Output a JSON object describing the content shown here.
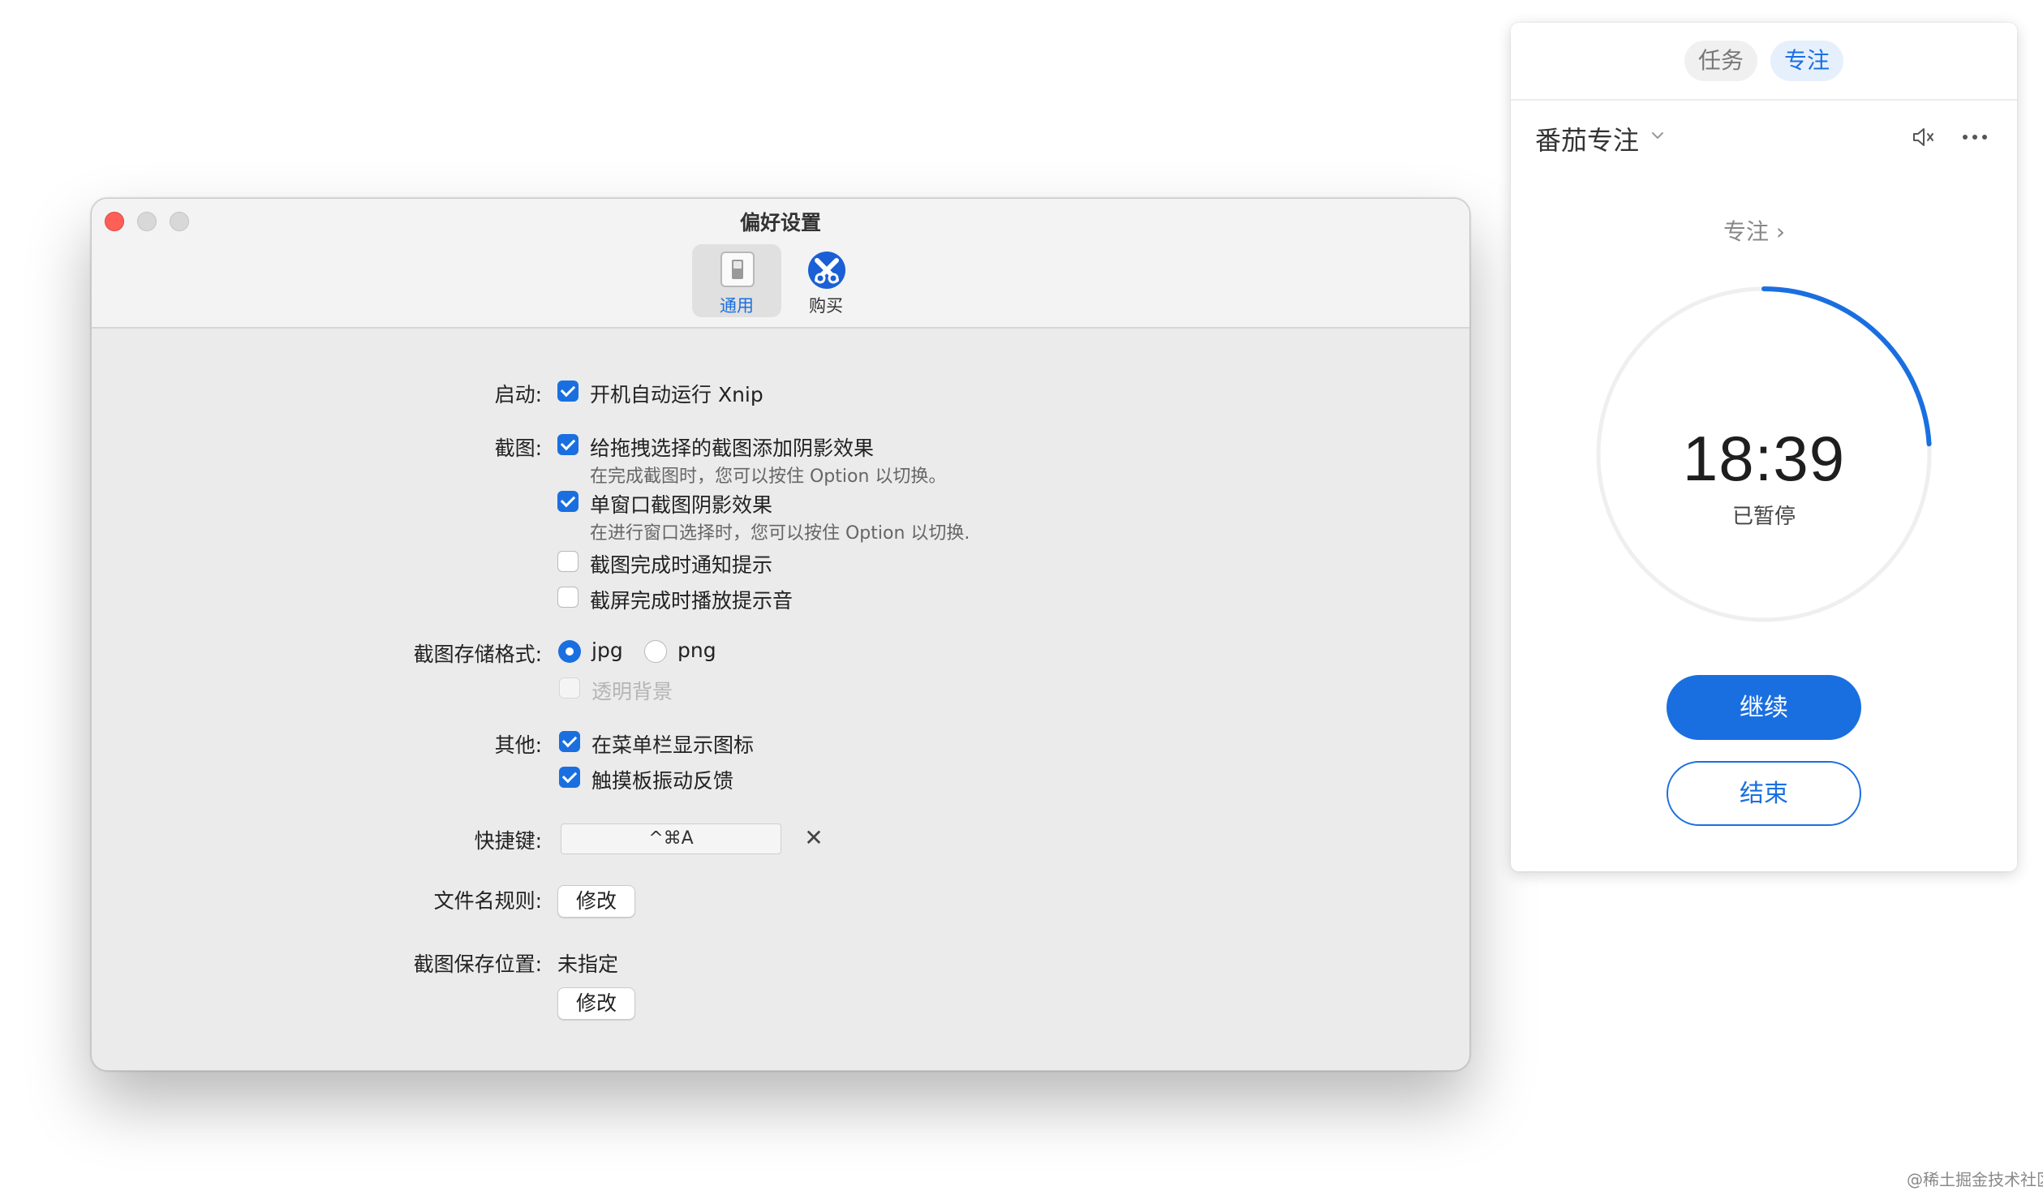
{
  "preferences": {
    "title": "偏好设置",
    "toolbar": {
      "general_label": "通用",
      "buy_label": "购买"
    },
    "startup": {
      "label": "启动:",
      "launch_at_login": {
        "text": "开机自动运行 Xnip",
        "checked": true
      }
    },
    "screenshot": {
      "label": "截图:",
      "drag_shadow": {
        "text": "给拖拽选择的截图添加阴影效果",
        "hint": "在完成截图时，您可以按住 Option 以切换。",
        "checked": true
      },
      "window_shadow": {
        "text": "单窗口截图阴影效果",
        "hint": "在进行窗口选择时，您可以按住 Option 以切换.",
        "checked": true
      },
      "notify_done": {
        "text": "截图完成时通知提示",
        "checked": false
      },
      "sound_done": {
        "text": "截屏完成时播放提示音",
        "checked": false
      }
    },
    "format": {
      "label": "截图存储格式:",
      "jpg": "jpg",
      "png": "png",
      "selected": "jpg",
      "transparent_bg": {
        "text": "透明背景",
        "checked": false,
        "disabled": true
      }
    },
    "other": {
      "label": "其他:",
      "menubar_icon": {
        "text": "在菜单栏显示图标",
        "checked": true
      },
      "haptic": {
        "text": "触摸板振动反馈",
        "checked": true
      }
    },
    "hotkey": {
      "label": "快捷键:",
      "value": "^⌘A",
      "clear": "✕"
    },
    "filename": {
      "label": "文件名规则:",
      "button": "修改"
    },
    "save_location": {
      "label": "截图保存位置:",
      "value": "未指定",
      "button": "修改"
    }
  },
  "focus_panel": {
    "tabs": {
      "tasks": "任务",
      "focus": "专注"
    },
    "title": "番茄专注",
    "mode_label": "专注 ›",
    "time": "18:39",
    "state": "已暂停",
    "progress": 0.24,
    "continue_button": "继续",
    "end_button": "结束",
    "accent_color": "#1a6fe0"
  },
  "watermark": "@稀土掘金技术社区"
}
